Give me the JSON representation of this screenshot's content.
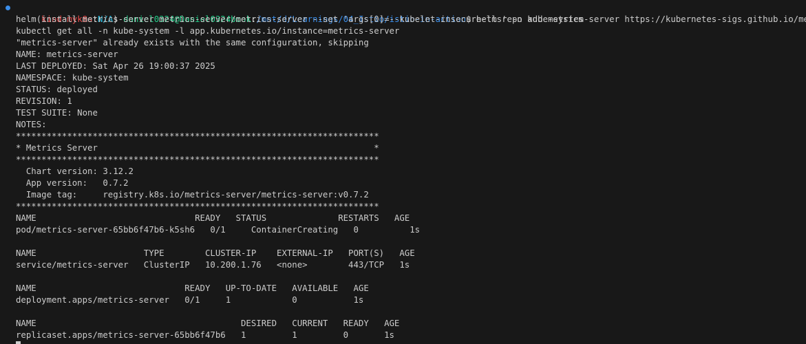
{
  "prompt": {
    "open_paren": "(",
    "context": "kind-myk8s",
    "sep": ":",
    "namespace": "N/A",
    "close_paren": ")",
    "space": " ",
    "user_host": "daniel0324@Daniel0324book",
    "colon": ":",
    "cwd": "/mnt/d/Learnings/04_Istio/istio-in-action",
    "symbol": "$ ",
    "command": "helm repo add metrics-server https://kubernetes-sigs.github.io/metrics-server/"
  },
  "lines": [
    "helm install metrics-server metrics-server/metrics-server --set 'args[0]=--kubelet-insecure-tls' -n kube-system",
    "kubectl get all -n kube-system -l app.kubernetes.io/instance=metrics-server",
    "\"metrics-server\" already exists with the same configuration, skipping",
    "NAME: metrics-server",
    "LAST DEPLOYED: Sat Apr 26 19:00:37 2025",
    "NAMESPACE: kube-system",
    "STATUS: deployed",
    "REVISION: 1",
    "TEST SUITE: None",
    "NOTES:",
    "***********************************************************************",
    "* Metrics Server                                                      *",
    "***********************************************************************",
    "  Chart version: 3.12.2",
    "  App version:   0.7.2",
    "  Image tag:     registry.k8s.io/metrics-server/metrics-server:v0.7.2",
    "***********************************************************************",
    "NAME                               READY   STATUS              RESTARTS   AGE",
    "pod/metrics-server-65bb6f47b6-k5sh6   0/1     ContainerCreating   0          1s",
    "",
    "NAME                     TYPE        CLUSTER-IP    EXTERNAL-IP   PORT(S)   AGE",
    "service/metrics-server   ClusterIP   10.200.1.76   <none>        443/TCP   1s",
    "",
    "NAME                             READY   UP-TO-DATE   AVAILABLE   AGE",
    "deployment.apps/metrics-server   0/1     1            0           1s",
    "",
    "NAME                                        DESIRED   CURRENT   READY   AGE",
    "replicaset.apps/metrics-server-65bb6f47b6   1         1         0       1s"
  ],
  "colors": {
    "background": "#181818",
    "foreground": "#cccccc",
    "context": "#f14c4c",
    "namespace": "#29b8db",
    "user_host": "#23d18b",
    "cwd": "#3b8eea",
    "status_dot": "#3b8eea"
  },
  "icons": {
    "status_dot": "command-status-dot-icon"
  }
}
